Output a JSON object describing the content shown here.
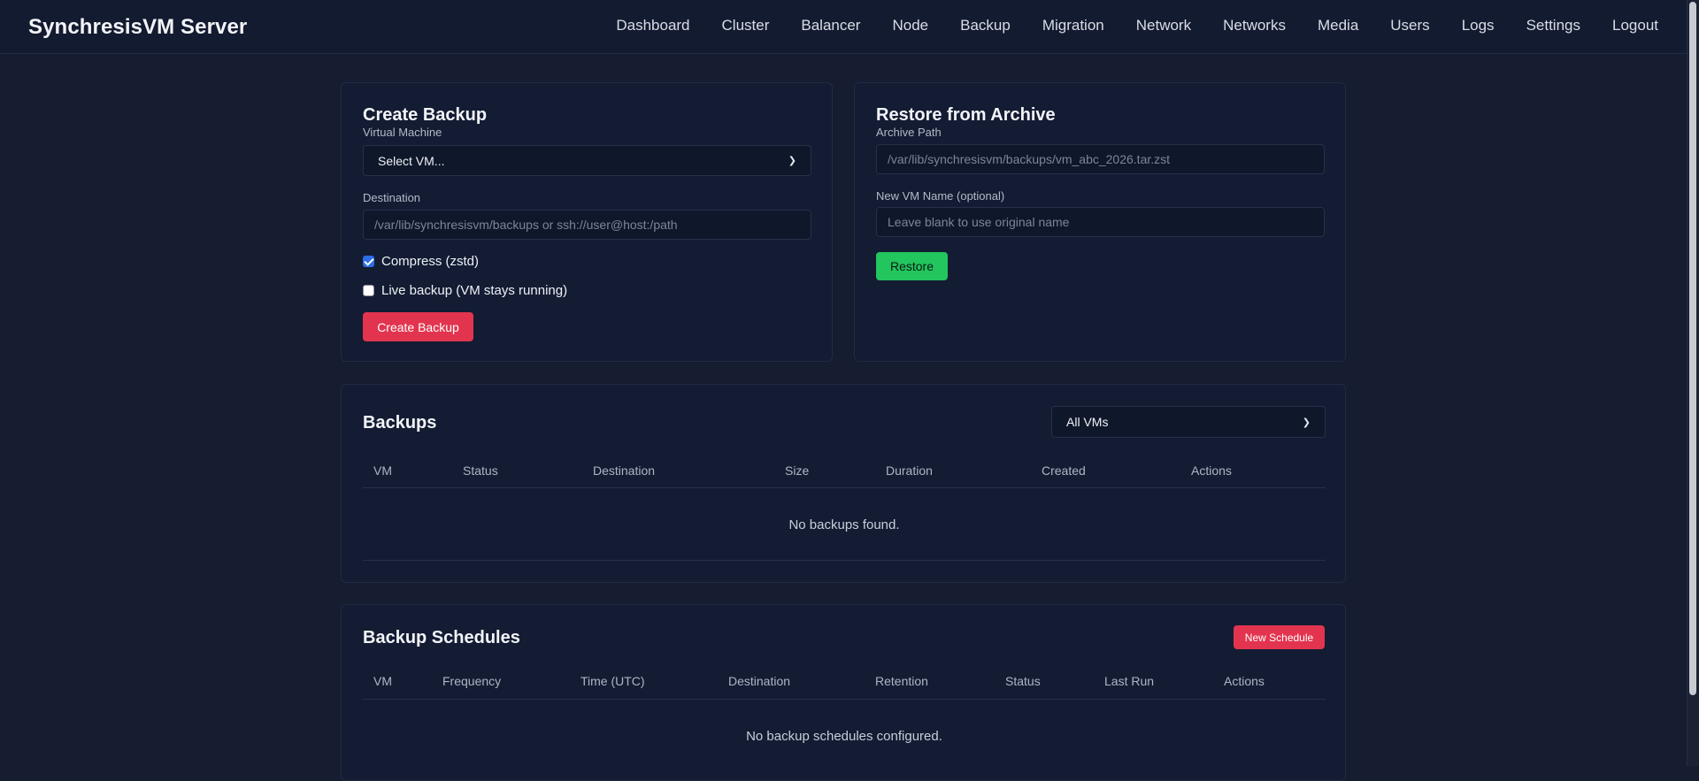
{
  "app": {
    "title": "SynchresisVM Server"
  },
  "nav": {
    "items": [
      "Dashboard",
      "Cluster",
      "Balancer",
      "Node",
      "Backup",
      "Migration",
      "Network",
      "Networks",
      "Media",
      "Users",
      "Logs",
      "Settings",
      "Logout"
    ]
  },
  "create_backup": {
    "title": "Create Backup",
    "vm_label": "Virtual Machine",
    "vm_selected": "Select VM...",
    "destination_label": "Destination",
    "destination_placeholder": "/var/lib/synchresisvm/backups or ssh://user@host:/path",
    "compress_label": "Compress (zstd)",
    "compress_checked": true,
    "live_label": "Live backup (VM stays running)",
    "live_checked": false,
    "button": "Create Backup"
  },
  "restore": {
    "title": "Restore from Archive",
    "archive_label": "Archive Path",
    "archive_placeholder": "/var/lib/synchresisvm/backups/vm_abc_2026.tar.zst",
    "name_label": "New VM Name (optional)",
    "name_placeholder": "Leave blank to use original name",
    "button": "Restore"
  },
  "backups": {
    "title": "Backups",
    "filter_selected": "All VMs",
    "columns": [
      "VM",
      "Status",
      "Destination",
      "Size",
      "Duration",
      "Created",
      "Actions"
    ],
    "empty": "No backups found."
  },
  "schedules": {
    "title": "Backup Schedules",
    "new_button": "New Schedule",
    "columns": [
      "VM",
      "Frequency",
      "Time (UTC)",
      "Destination",
      "Retention",
      "Status",
      "Last Run",
      "Actions"
    ],
    "empty": "No backup schedules configured."
  },
  "colors": {
    "accent_red": "#e3344f",
    "accent_green": "#22c55e",
    "background": "#161d30",
    "card": "#131c33"
  }
}
